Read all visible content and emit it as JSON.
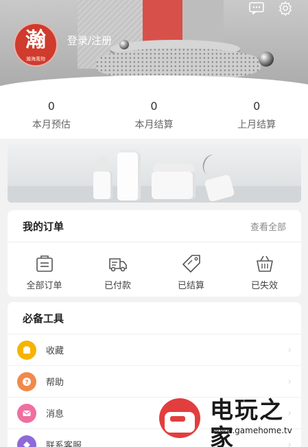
{
  "header": {
    "avatar_char": "瀚",
    "avatar_sub": "瀚海風物",
    "login_label": "登录/注册",
    "icons": {
      "message": "message-icon",
      "settings": "gear-icon"
    }
  },
  "stats": [
    {
      "value": "0",
      "label": "本月预估"
    },
    {
      "value": "0",
      "label": "本月结算"
    },
    {
      "value": "0",
      "label": "上月结算"
    }
  ],
  "orders": {
    "title": "我的订单",
    "view_all": "查看全部",
    "items": [
      {
        "label": "全部订单",
        "icon": "order-list-icon"
      },
      {
        "label": "已付款",
        "icon": "delivery-truck-icon"
      },
      {
        "label": "已结算",
        "icon": "price-tag-icon"
      },
      {
        "label": "已失效",
        "icon": "basket-icon"
      }
    ]
  },
  "tools": {
    "title": "必备工具",
    "items": [
      {
        "label": "收藏",
        "icon": "favorite-icon",
        "color": "#f5b400"
      },
      {
        "label": "帮助",
        "icon": "help-icon",
        "color": "#f08a4b"
      },
      {
        "label": "消息",
        "icon": "mail-icon",
        "color": "#ef6fa0"
      },
      {
        "label": "联系客服",
        "icon": "customer-service-icon",
        "color": "#8e6ad8"
      }
    ]
  },
  "watermark": {
    "brand": "电玩之家",
    "url": "www.gamehome.tv"
  },
  "colors": {
    "brand_red": "#cf3b2c",
    "background": "#f2f2f2"
  }
}
